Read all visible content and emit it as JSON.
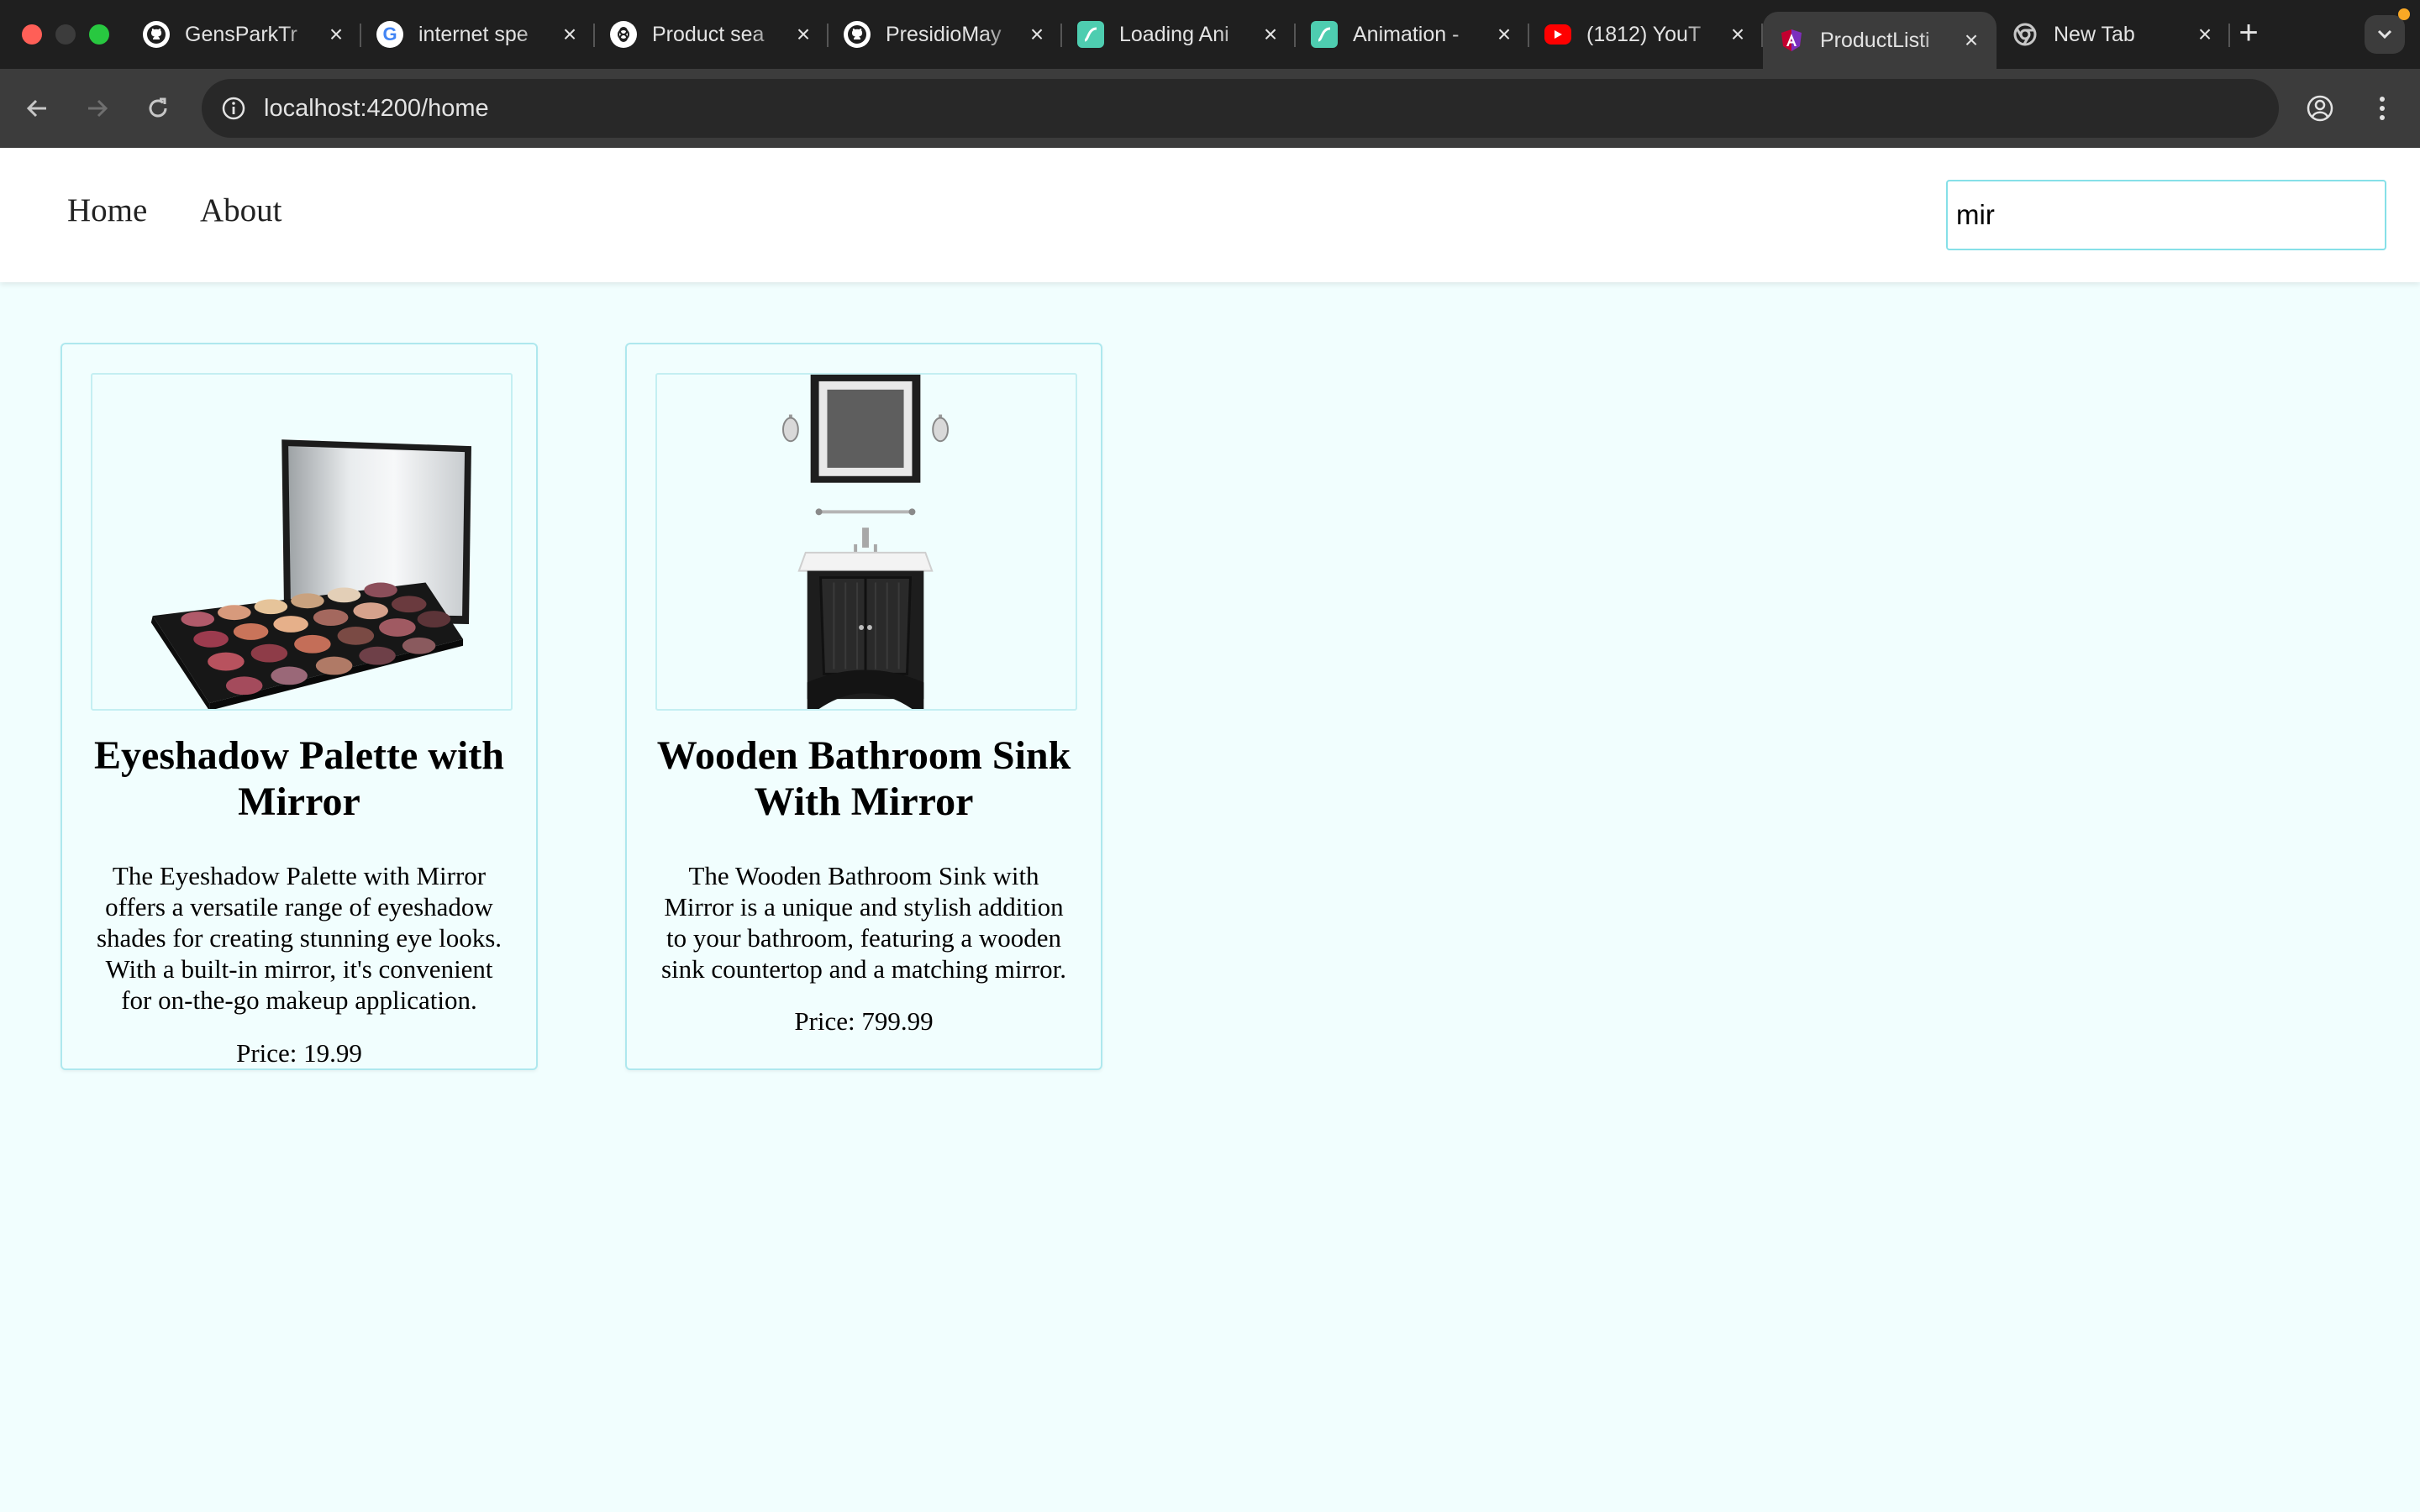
{
  "browser": {
    "tabs": [
      {
        "title": "GensParkTr",
        "icon": "github-icon"
      },
      {
        "title": "internet spe",
        "icon": "google-icon"
      },
      {
        "title": "Product sea",
        "icon": "openai-icon"
      },
      {
        "title": "PresidioMay",
        "icon": "github-icon"
      },
      {
        "title": "Loading Ani",
        "icon": "animation-app-icon"
      },
      {
        "title": "Animation -",
        "icon": "animation-app-icon"
      },
      {
        "title": "(1812) YouT",
        "icon": "youtube-icon"
      },
      {
        "title": "ProductListi",
        "icon": "angular-icon",
        "active": true
      },
      {
        "title": "New Tab",
        "icon": "chrome-icon"
      }
    ],
    "url": "localhost:4200/home"
  },
  "header": {
    "nav": {
      "home": "Home",
      "about": "About"
    },
    "search": {
      "value": "mir",
      "placeholder": ""
    }
  },
  "products": [
    {
      "name": "Eyeshadow Palette with Mirror",
      "description": "The Eyeshadow Palette with Mirror offers a versatile range of eyeshadow shades for creating stunning eye looks. With a built-in mirror, it's convenient for on-the-go makeup application.",
      "price": "Price: 19.99"
    },
    {
      "name": "Wooden Bathroom Sink With Mirror",
      "description": "The Wooden Bathroom Sink with Mirror is a unique and stylish addition to your bathroom, featuring a wooden sink countertop and a matching mirror.",
      "price": "Price: 799.99"
    }
  ]
}
